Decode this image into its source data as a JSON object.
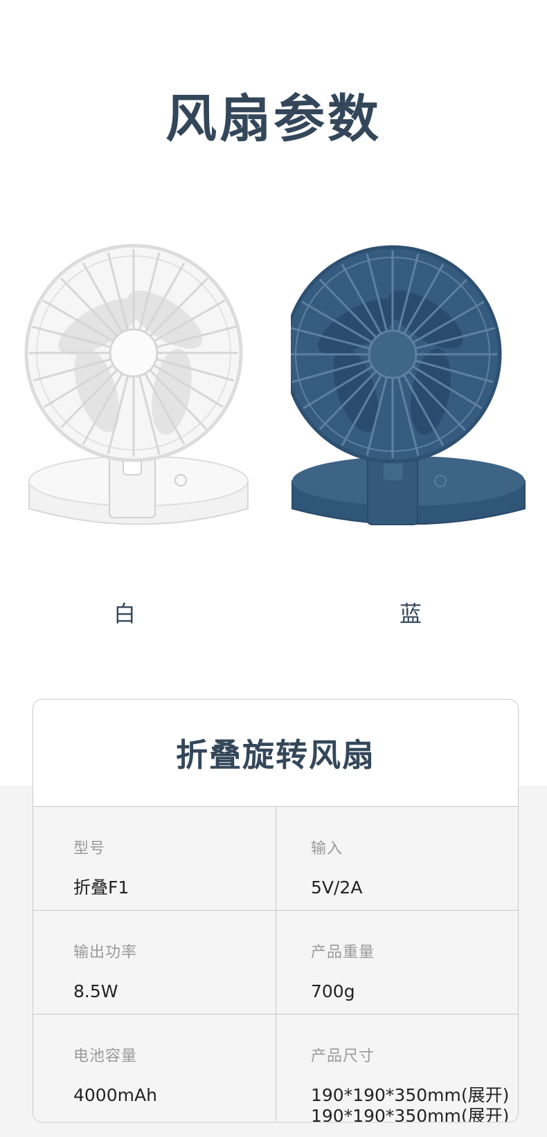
{
  "page_title": "风扇参数",
  "variants": [
    {
      "label": "白",
      "color": "#f1f1f1"
    },
    {
      "label": "蓝",
      "color": "#33577a"
    }
  ],
  "spec_card": {
    "title": "折叠旋转风扇",
    "rows": [
      [
        {
          "label": "型号",
          "value": "折叠F1"
        },
        {
          "label": "输入",
          "value": "5V/2A"
        }
      ],
      [
        {
          "label": "输出功率",
          "value": "8.5W"
        },
        {
          "label": "产品重量",
          "value": "700g"
        }
      ],
      [
        {
          "label": "电池容量",
          "value": "4000mAh"
        },
        {
          "label": "产品尺寸",
          "value": "190*190*350mm(展开)",
          "value2": "190*190*350mm(展开)"
        }
      ]
    ]
  }
}
